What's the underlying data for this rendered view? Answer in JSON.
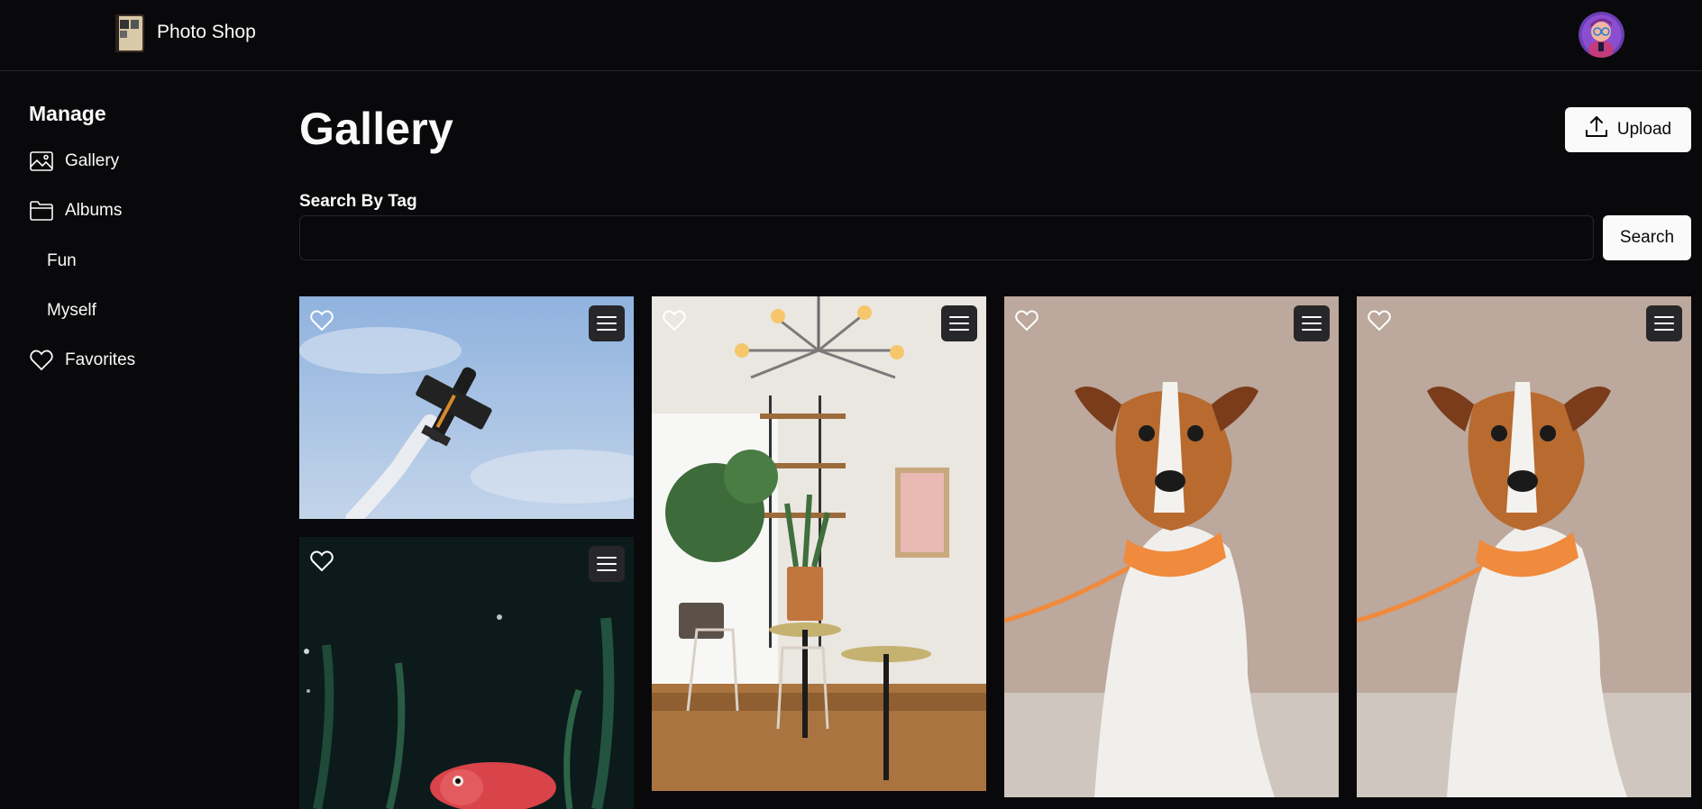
{
  "header": {
    "app_title": "Photo Shop",
    "logo_icon": "photo-album-logo",
    "avatar_icon": "user-avatar"
  },
  "sidebar": {
    "heading": "Manage",
    "items": [
      {
        "label": "Gallery",
        "icon": "image-icon"
      },
      {
        "label": "Albums",
        "icon": "folder-icon"
      },
      {
        "label": "Fun",
        "icon": ""
      },
      {
        "label": "Myself",
        "icon": ""
      },
      {
        "label": "Favorites",
        "icon": "heart-icon"
      }
    ]
  },
  "main": {
    "title": "Gallery",
    "upload_label": "Upload",
    "search": {
      "label": "Search By Tag",
      "value": "",
      "placeholder": "",
      "button_label": "Search"
    }
  },
  "photos": [
    {
      "subject": "aerobatic plane with smoke trail",
      "favorited": false
    },
    {
      "subject": "cafe interior with plants and pendant lights",
      "favorited": false
    },
    {
      "subject": "terrier dog with orange collar",
      "favorited": false
    },
    {
      "subject": "terrier dog with orange collar",
      "favorited": false
    },
    {
      "subject": "red fish in aquarium",
      "favorited": false
    }
  ],
  "colors": {
    "background": "#09090b",
    "border": "#27272a",
    "button_bg": "#fafafa",
    "text": "#fafafa"
  }
}
